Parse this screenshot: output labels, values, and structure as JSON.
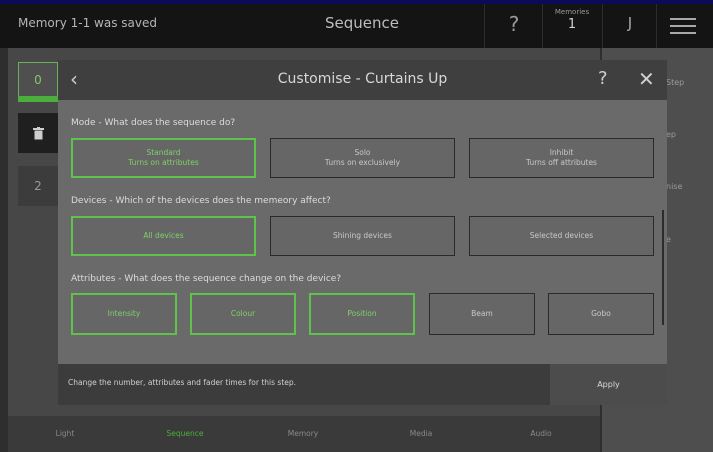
{
  "topbar": {
    "status": "Memory 1-1 was saved",
    "title": "Sequence",
    "help": "?",
    "memories_label": "Memories",
    "memories_count": "1",
    "user_initial": "J"
  },
  "steps": {
    "selected": "0",
    "second": "2"
  },
  "right_panel": [
    "Step",
    "ep",
    "nise",
    "e"
  ],
  "bottom_tabs": [
    "Light",
    "Sequence",
    "Memory",
    "Media",
    "Audio"
  ],
  "dialog": {
    "title": "Customise - Curtains Up",
    "help": "?",
    "mode": {
      "label": "Mode - What does the sequence do?",
      "options": [
        {
          "title": "Standard",
          "subtitle": "Turns on attributes",
          "selected": true
        },
        {
          "title": "Solo",
          "subtitle": "Turns on exclusively",
          "selected": false
        },
        {
          "title": "Inhibit",
          "subtitle": "Turns off attributes",
          "selected": false
        }
      ]
    },
    "devices": {
      "label": "Devices - Which of the devices does the memeory affect?",
      "options": [
        {
          "title": "All devices",
          "selected": true
        },
        {
          "title": "Shining devices",
          "selected": false
        },
        {
          "title": "Selected devices",
          "selected": false
        }
      ]
    },
    "attributes": {
      "label": "Attributes - What does the sequence change on the device?",
      "options": [
        {
          "title": "Intensity",
          "selected": true
        },
        {
          "title": "Colour",
          "selected": true
        },
        {
          "title": "Position",
          "selected": true
        },
        {
          "title": "Beam",
          "selected": false
        },
        {
          "title": "Gobo",
          "selected": false
        }
      ]
    },
    "footer_hint": "Change the number, attributes and fader times for this step.",
    "apply_label": "Apply"
  },
  "colors": {
    "accent_green": "#5fc24a",
    "topbar_border": "#0b0b5a"
  }
}
